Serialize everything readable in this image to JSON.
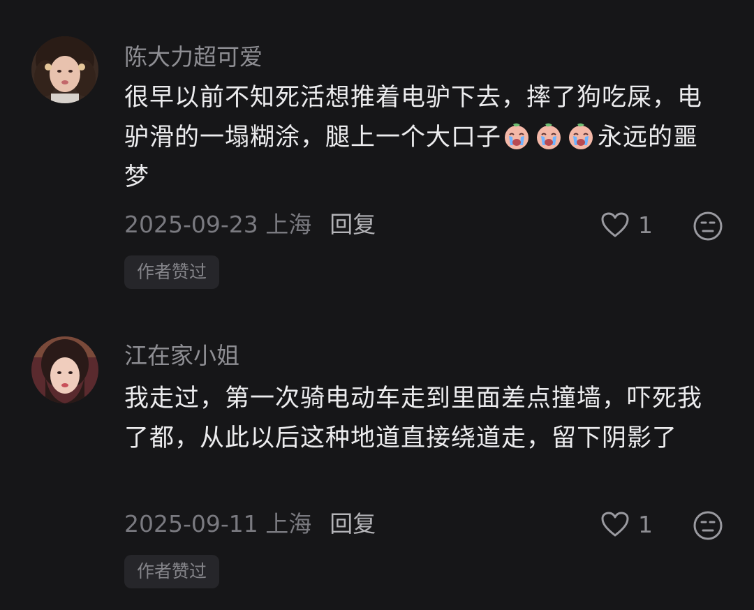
{
  "colors": {
    "background": "#161618",
    "username": "#8e8e93",
    "body_text": "#ececee",
    "meta_text": "#7a7a80",
    "reply_text": "#b4b4b8",
    "badge_bg": "#26262a"
  },
  "comments": [
    {
      "username": "陈大力超可爱",
      "avatar": "avatar-photo",
      "text_parts": [
        "很早以前不知死活想推着电驴下去，摔了狗吃屎，电驴滑的一塌糊涂，腿上一个大口子",
        "永远的噩梦"
      ],
      "emojis": [
        "loudly-crying-face-icon",
        "loudly-crying-face-icon",
        "loudly-crying-face-icon"
      ],
      "date": "2025-09-23",
      "location": "上海",
      "reply_label": "回复",
      "like_icon": "heart-outline-icon",
      "like_count": "1",
      "dislike_icon": "unamused-face-icon",
      "badge": "作者赞过"
    },
    {
      "username": "江在家小姐",
      "avatar": "avatar-photo",
      "text_parts": [
        "我走过，第一次骑电动车走到里面差点撞墙，吓死我了都，从此以后这种地道直接绕道走，留下阴影了"
      ],
      "date": "2025-09-11",
      "location": "上海",
      "reply_label": "回复",
      "like_icon": "heart-outline-icon",
      "like_count": "1",
      "dislike_icon": "unamused-face-icon",
      "badge": "作者赞过"
    }
  ]
}
